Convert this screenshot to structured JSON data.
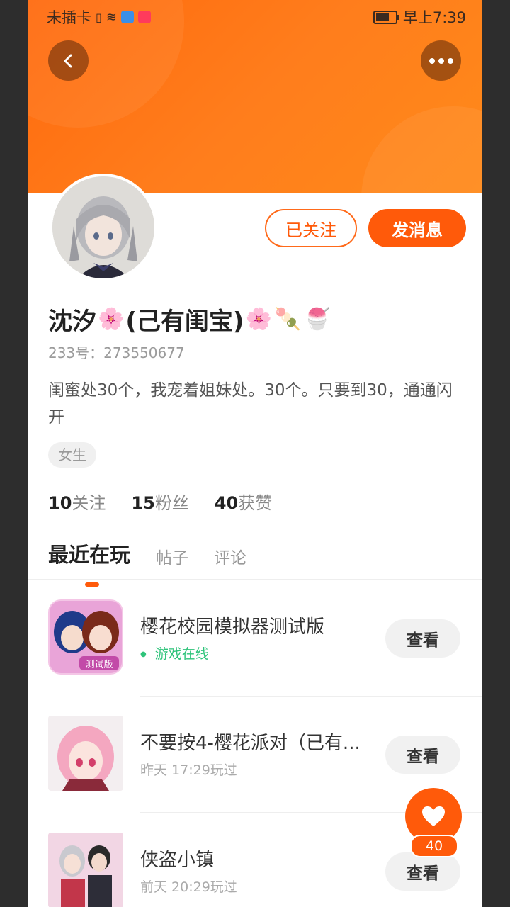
{
  "status_bar": {
    "carrier": "未插卡",
    "time": "早上7:39"
  },
  "header": {
    "back_icon": "chevron-left-icon",
    "more_icon": "more-dots-icon"
  },
  "profile": {
    "name_prefix": "沈汐",
    "name_middle": "(己有闺宝)",
    "emoji_1": "🌸",
    "emoji_2": "🌸",
    "emoji_3": "🍡",
    "emoji_4": "🍧",
    "uid": "233号：273550677",
    "bio": "闺蜜处30个，我宠着姐妹处。30个。只要到30，通通闪开",
    "tag": "女生",
    "follow_label": "已关注",
    "message_label": "发消息"
  },
  "stats": {
    "following_count": "10",
    "following_label": "关注",
    "fans_count": "15",
    "fans_label": "粉丝",
    "likes_count": "40",
    "likes_label": "获赞"
  },
  "tabs": [
    "最近在玩",
    "帖子",
    "评论"
  ],
  "games": [
    {
      "title": "樱花校园模拟器测试版",
      "sub": "游戏在线",
      "button": "查看"
    },
    {
      "title": "不要按4-樱花派对（已有...",
      "sub": "昨天 17:29玩过",
      "button": "查看"
    },
    {
      "title": "侠盗小镇",
      "sub": "前天 20:29玩过",
      "button": "查看"
    }
  ],
  "fab": {
    "icon": "heart-icon",
    "count": "40"
  },
  "colors": {
    "accent": "#ff5a0a",
    "header": "#ff7a1a",
    "online": "#2ec37a"
  }
}
